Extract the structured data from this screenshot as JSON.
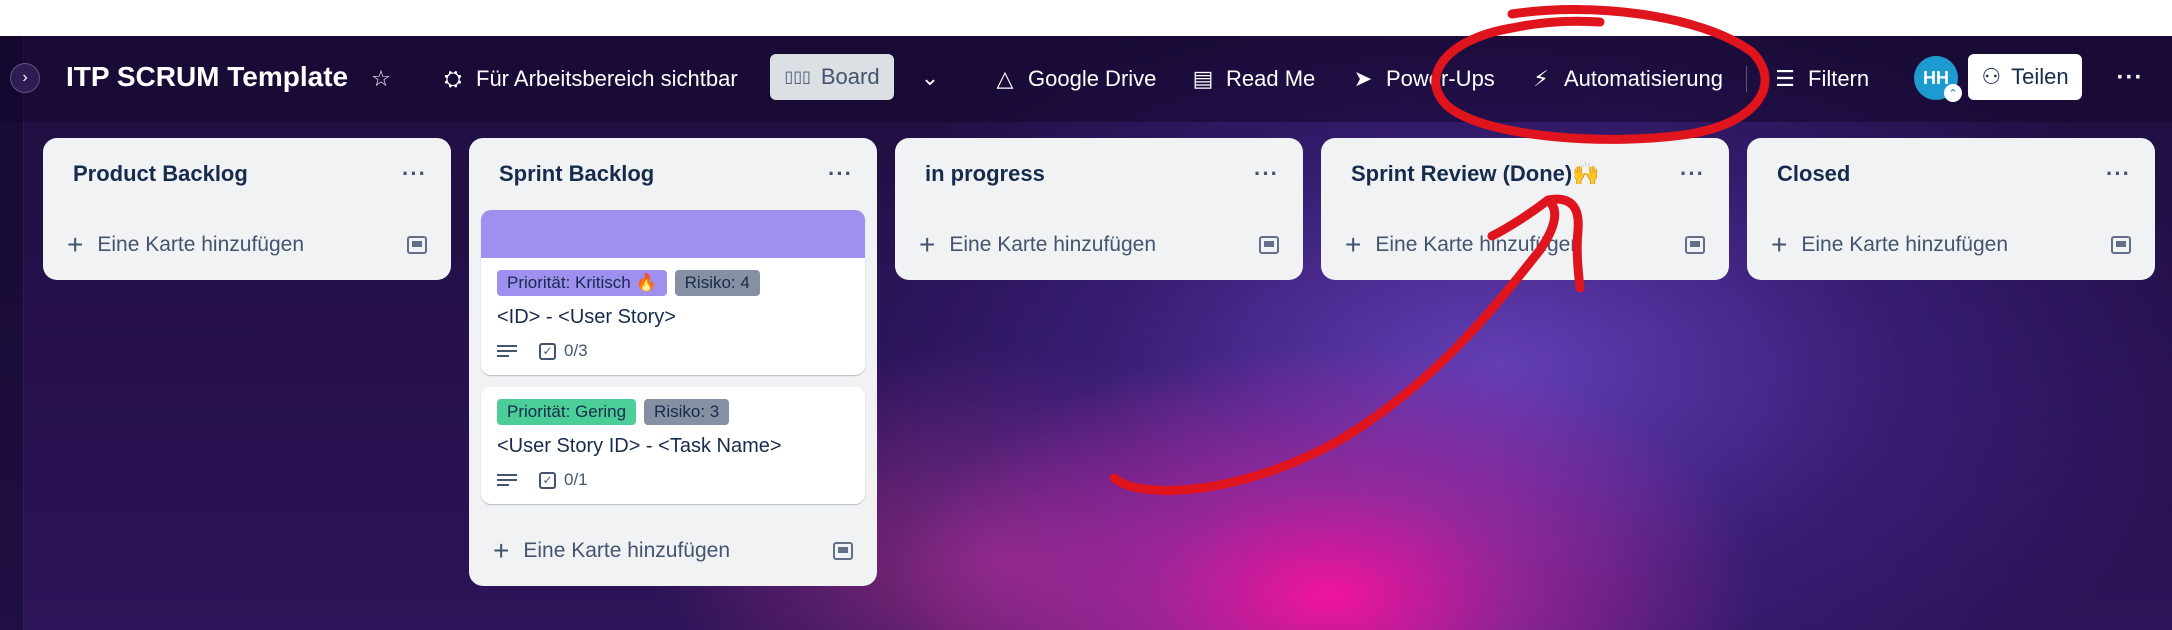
{
  "topbar": {
    "expand_icon": "chevron-right-icon",
    "title": "ITP SCRUM Template",
    "star_icon": "star-icon",
    "visibility_label": "Für Arbeitsbereich sichtbar",
    "view_label": "Board",
    "google_drive_label": "Google Drive",
    "read_me_label": "Read Me",
    "power_ups_label": "Power-Ups",
    "automation_label": "Automatisierung",
    "filter_label": "Filtern",
    "avatar_initials": "HH",
    "share_label": "Teilen",
    "more_label": "···"
  },
  "lists": [
    {
      "title": "Product Backlog",
      "more": "···",
      "add_card": "Eine Karte hinzufügen"
    },
    {
      "title": "Sprint Backlog",
      "more": "···",
      "add_card": "Eine Karte hinzufügen",
      "cards": [
        {
          "cover_color": "#9f8fef",
          "labels": [
            {
              "text": "Priorität: Kritisch 🔥",
              "color": "#9f8fef"
            },
            {
              "text": "Risiko: 4",
              "color": "#8590a2"
            }
          ],
          "title": "<ID> - <User Story>",
          "checklist": "0/3"
        },
        {
          "labels": [
            {
              "text": "Priorität: Gering",
              "color": "#4bce97"
            },
            {
              "text": "Risiko: 3",
              "color": "#8590a2"
            }
          ],
          "title": "<User Story ID> - <Task Name>",
          "checklist": "0/1"
        }
      ]
    },
    {
      "title": "in progress",
      "more": "···",
      "add_card": "Eine Karte hinzufügen"
    },
    {
      "title": "Sprint Review (Done)🙌",
      "more": "···",
      "add_card": "Eine Karte hinzufügen"
    },
    {
      "title": "Closed",
      "more": "···",
      "add_card": "Eine Karte hinzufügen"
    }
  ],
  "annotation": {
    "color": "#e0141c",
    "shape": "circle-and-arrow",
    "target": "Automatisierung"
  }
}
